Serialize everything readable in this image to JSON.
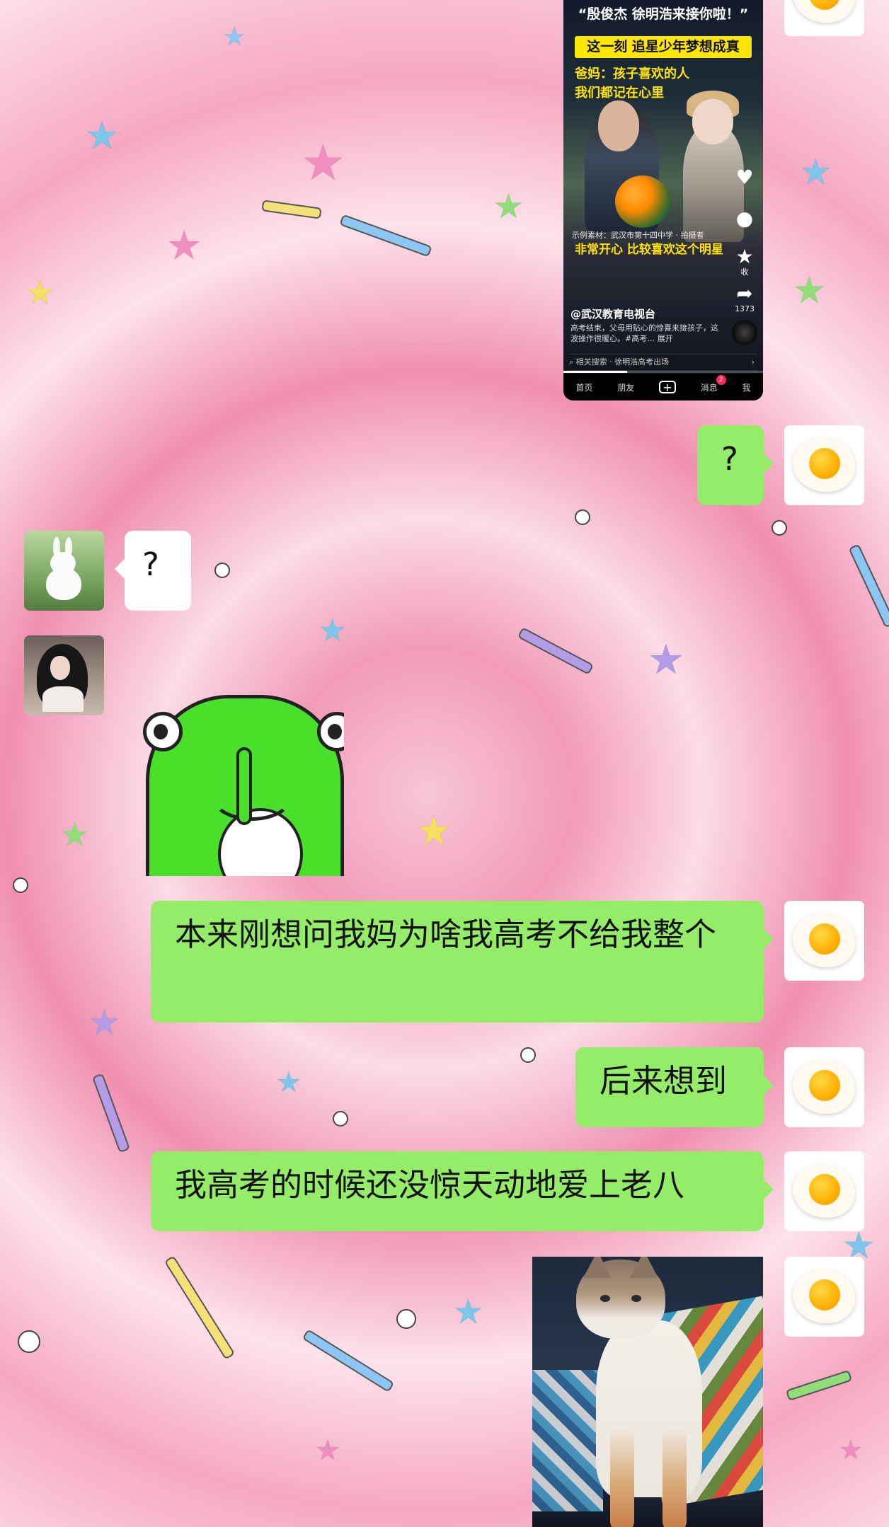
{
  "chat": {
    "video_card": {
      "title": "“殷俊杰 徐明浩来接你啦！”",
      "banner": "这一刻 追星少年梦想成真",
      "caption_lines": [
        "爸妈：孩子喜欢的人",
        "我们都记在心里"
      ],
      "source": "示例素材：武汉市第十四中学 · 拍摄者",
      "quote": "非常开心 比较喜欢这个明星",
      "side": {
        "star_count": "收",
        "share_count": "1373"
      },
      "author": "@武汉教育电视台",
      "description": "高考结束，父母用贴心的惊喜来接孩子，这波操作很暖心。#高考… 展开",
      "search": "相关搜索 · 徐明浩高考出场",
      "progress": 0.32,
      "tabs": [
        "首页",
        "朋友",
        "+",
        "消息",
        "我"
      ],
      "badge": "2"
    },
    "messages": [
      {
        "text": "?"
      },
      {
        "text": "?"
      },
      {
        "text": "本来刚想问我妈为啥我高考不给我整个"
      },
      {
        "text": "后来想到"
      },
      {
        "text": "我高考的时候还没惊天动地爱上老八"
      }
    ]
  },
  "colors": {
    "sent_bubble": "#95ec69",
    "received_bubble": "#ffffff",
    "accent_yellow": "#ffe600"
  },
  "icons": [
    "fried-egg-avatar-icon",
    "bunny-avatar-icon",
    "girl-avatar-icon",
    "frog-sticker-icon",
    "cat-photo-icon",
    "star-icon",
    "share-icon",
    "heart-icon",
    "comment-icon",
    "search-icon",
    "chevron-right-icon"
  ]
}
